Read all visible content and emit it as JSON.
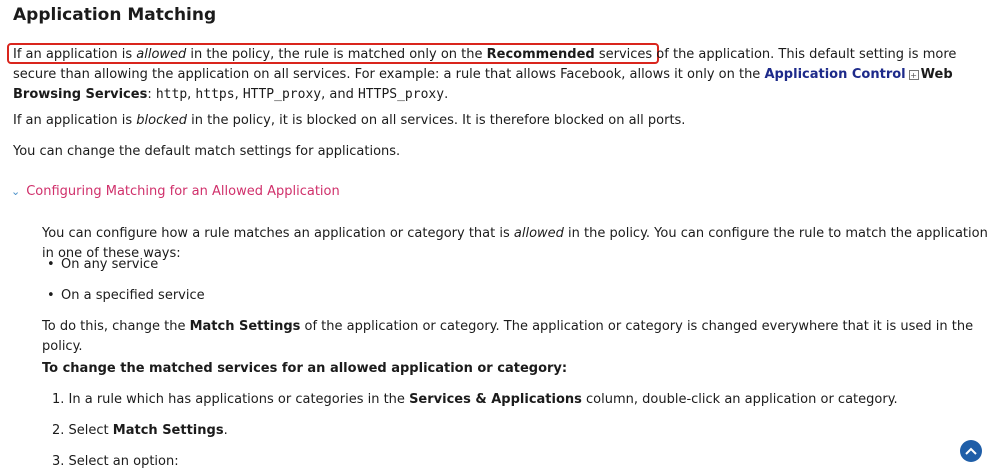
{
  "title": "Application Matching",
  "para1": {
    "t1": "If an application is ",
    "t1_em": "allowed",
    "t2": " in the policy, the rule is matched only on the ",
    "t2_strong": "Recommended",
    "t3": " services of the application.",
    "t4": " This default setting is more secure than allowing the application on all services. For example: a rule that allows Facebook, allows it only on the ",
    "link": "Application Control",
    "link_icon": "expand-icon",
    "t5_strong": "Web Browsing Services",
    "t6": ": ",
    "code1": "http",
    "code2": "https",
    "code3": "HTTP_proxy",
    "t_and": ", and ",
    "code4": "HTTPS_proxy",
    "t_end": "."
  },
  "para2": {
    "t1": "If an application is ",
    "em": "blocked",
    "t2": " in the policy, it is blocked on all services. It is therefore blocked on all ports."
  },
  "para3": "You can change the default match settings for applications.",
  "toggle": {
    "icon": "chevron-down-icon",
    "label": "Configuring Matching for an Allowed Application"
  },
  "section": {
    "intro_t1": "You can configure how a rule matches an application or category that is ",
    "intro_em": "allowed",
    "intro_t2": " in the policy. You can configure the rule to match the application in one of these ways:",
    "bullets": [
      "On any service",
      "On a specified service"
    ],
    "todo_t1": "To do this, change the ",
    "todo_strong": "Match Settings",
    "todo_t2": " of the application or category. The application or category is changed everywhere that it is used in the policy.",
    "procedure_title": "To change the matched services for an allowed application or category:",
    "steps": {
      "s1_t1": "1. In a rule which has applications or categories in the ",
      "s1_strong": "Services & Applications",
      "s1_t2": " column, double-click an application or category.",
      "s2_t1": "2. Select ",
      "s2_strong": "Match Settings",
      "s2_t2": ".",
      "s3": "3. Select an option:"
    }
  },
  "scroll_top_icon": "chevron-up-icon",
  "accent_colors": {
    "highlight": "#d9251d",
    "toggle": "#d0306b",
    "link": "#1d2a8a",
    "scroll_button": "#1f5ea8"
  }
}
